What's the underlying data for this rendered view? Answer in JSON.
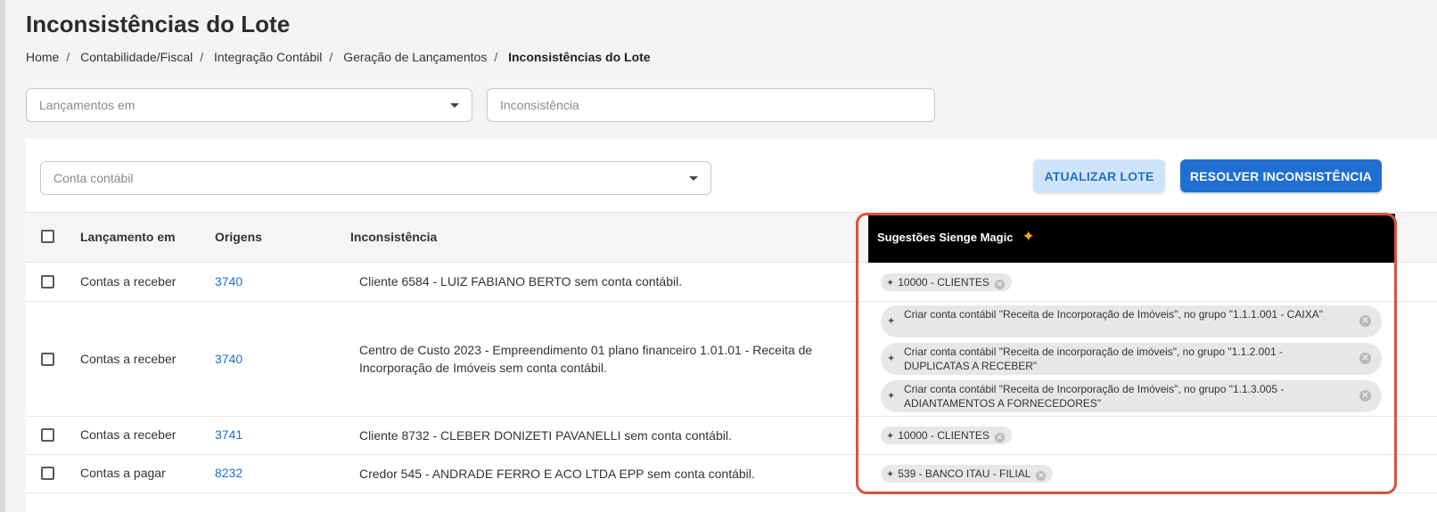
{
  "page": {
    "title": "Inconsistências do Lote",
    "breadcrumb": [
      "Home",
      "Contabilidade/Fiscal",
      "Integração Contábil",
      "Geração de Lançamentos",
      "Inconsistências do Lote"
    ]
  },
  "filters": {
    "lancamentos_placeholder": "Lançamentos em",
    "inconsistencia_placeholder": "Inconsistência",
    "conta_placeholder": "Conta contábil"
  },
  "actions": {
    "atualizar_label": "ATUALIZAR LOTE",
    "resolver_label": "RESOLVER INCONSISTÊNCIA"
  },
  "table": {
    "headers": {
      "lancamento": "Lançamento em",
      "origens": "Origens",
      "inconsistencia": "Inconsistência",
      "sugestoes": "Sugestões Sienge Magic"
    },
    "rows": [
      {
        "lancamento": "Contas a receber",
        "origem": "3740",
        "inconsistencia": "Cliente 6584 - LUIZ FABIANO BERTO sem conta contábil.",
        "sugestoes": [
          "10000 - CLIENTES"
        ]
      },
      {
        "lancamento": "Contas a receber",
        "origem": "3740",
        "inconsistencia": "Centro de Custo 2023 - Empreendimento 01 plano financeiro 1.01.01 - Receita de Incorporação de Imóveis sem conta contábil.",
        "sugestoes": [
          "Criar conta contábil \"Receita de Incorporação de Imóveis\", no grupo \"1.1.1.001 - CAIXA\"",
          "Criar conta contábil \"Receita de incorporação de imóveis\", no grupo \"1.1.2.001 - DUPLICATAS A RECEBER\"",
          "Criar conta contábil \"Receita de Incorporação de Imóveis\", no grupo \"1.1.3.005 - ADIANTAMENTOS A FORNECEDORES\""
        ]
      },
      {
        "lancamento": "Contas a receber",
        "origem": "3741",
        "inconsistencia": "Cliente 8732 - CLEBER DONIZETI PAVANELLI sem conta contábil.",
        "sugestoes": [
          "10000 - CLIENTES"
        ]
      },
      {
        "lancamento": "Contas a pagar",
        "origem": "8232",
        "inconsistencia": "Credor 545 - ANDRADE FERRO E ACO LTDA EPP sem conta contábil.",
        "sugestoes": [
          "539 - BANCO ITAU - FILIAL"
        ]
      }
    ]
  },
  "colors": {
    "accent": "#1e6fd0",
    "accent_light": "#cfe4fb",
    "highlight": "#d9523d",
    "magic_star": "#f7a21b"
  }
}
